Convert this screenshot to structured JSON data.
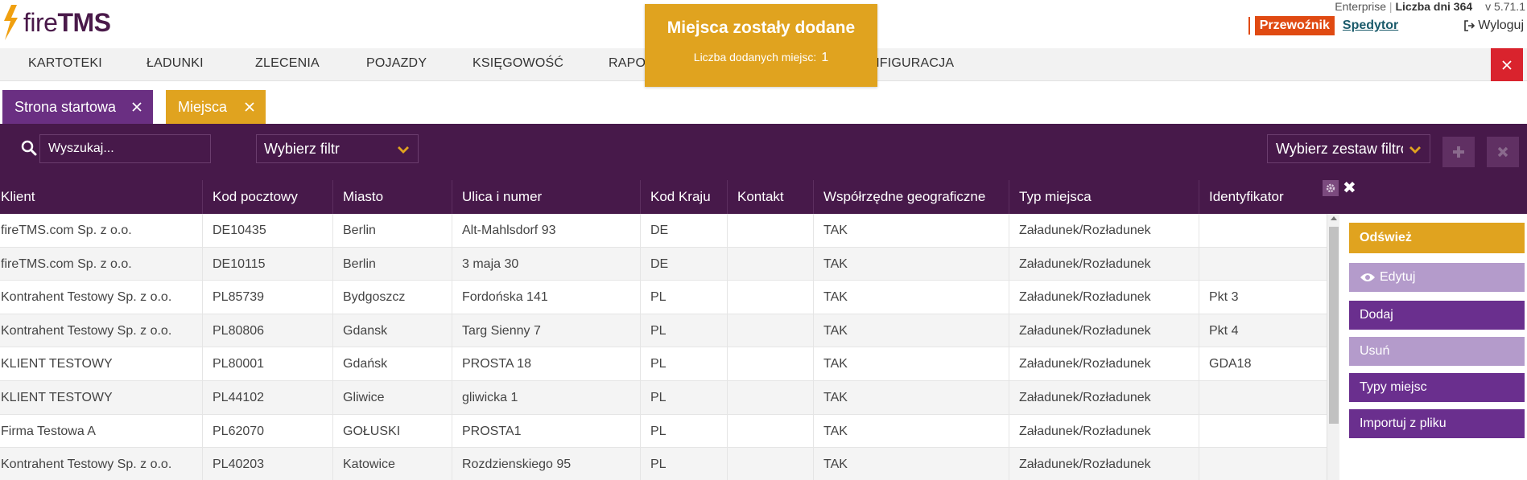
{
  "app": {
    "logo_text_bold": "TMS",
    "logo_text_light": "fire"
  },
  "topbar": {
    "edition": "Enterprise",
    "days_label": "Liczba dni 364",
    "version": "v 5.71.1",
    "carrier": "Przewoźnik",
    "forwarder": "Spedytor",
    "logout": "Wyloguj"
  },
  "nav": {
    "items": [
      "KARTOTEKI",
      "ŁADUNKI",
      "ZLECENIA",
      "POJAZDY",
      "KSIĘGOWOŚĆ",
      "RAPO",
      "NFIGURACJA"
    ]
  },
  "toast": {
    "title": "Miejsca zostały dodane",
    "label": "Liczba dodanych miejsc:",
    "count": "1"
  },
  "tabs": [
    {
      "label": "Strona startowa",
      "color": "#6a2f82"
    },
    {
      "label": "Miejsca",
      "color": "#e0a31f"
    }
  ],
  "filters": {
    "search_placeholder": "Wyszukaj...",
    "filter_select": "Wybierz filtr",
    "set_select": "Wybierz zestaw filtrów"
  },
  "table": {
    "columns": [
      "Klient",
      "Kod pocztowy",
      "Miasto",
      "Ulica i numer",
      "Kod Kraju",
      "Kontakt",
      "Współrzędne geograficzne",
      "Typ miejsca",
      "Identyfikator"
    ],
    "rows": [
      [
        "fireTMS.com Sp. z o.o.",
        "DE10435",
        "Berlin",
        "Alt-Mahlsdorf 93",
        "DE",
        "",
        "TAK",
        "Załadunek/Rozładunek",
        ""
      ],
      [
        "fireTMS.com Sp. z o.o.",
        "DE10115",
        "Berlin",
        "3 maja 30",
        "DE",
        "",
        "TAK",
        "Załadunek/Rozładunek",
        ""
      ],
      [
        "Kontrahent Testowy Sp. z o.o.",
        "PL85739",
        "Bydgoszcz",
        "Fordońska 141",
        "PL",
        "",
        "TAK",
        "Załadunek/Rozładunek",
        "Pkt 3"
      ],
      [
        "Kontrahent Testowy Sp. z o.o.",
        "PL80806",
        "Gdansk",
        "Targ Sienny 7",
        "PL",
        "",
        "TAK",
        "Załadunek/Rozładunek",
        "Pkt 4"
      ],
      [
        "KLIENT TESTOWY",
        "PL80001",
        "Gdańsk",
        "PROSTA 18",
        "PL",
        "",
        "TAK",
        "Załadunek/Rozładunek",
        "GDA18"
      ],
      [
        "KLIENT TESTOWY",
        "PL44102",
        "Gliwice",
        "gliwicka 1",
        "PL",
        "",
        "TAK",
        "Załadunek/Rozładunek",
        ""
      ],
      [
        "Firma Testowa A",
        "PL62070",
        "GOŁUSKI",
        "PROSTA1",
        "PL",
        "",
        "TAK",
        "Załadunek/Rozładunek",
        ""
      ],
      [
        "Kontrahent Testowy Sp. z o.o.",
        "PL40203",
        "Katowice",
        "Rozdzienskiego 95",
        "PL",
        "",
        "TAK",
        "Załadunek/Rozładunek",
        ""
      ]
    ]
  },
  "side": {
    "refresh": "Odśwież",
    "edit": "Edytuj",
    "add": "Dodaj",
    "delete": "Usuń",
    "types": "Typy miejsc",
    "import": "Importuj z pliku"
  },
  "colors": {
    "brand_purple": "#47194a",
    "accent_orange": "#e0a31f",
    "danger_red": "#d9232d",
    "carrier_badge": "#e04a12"
  }
}
